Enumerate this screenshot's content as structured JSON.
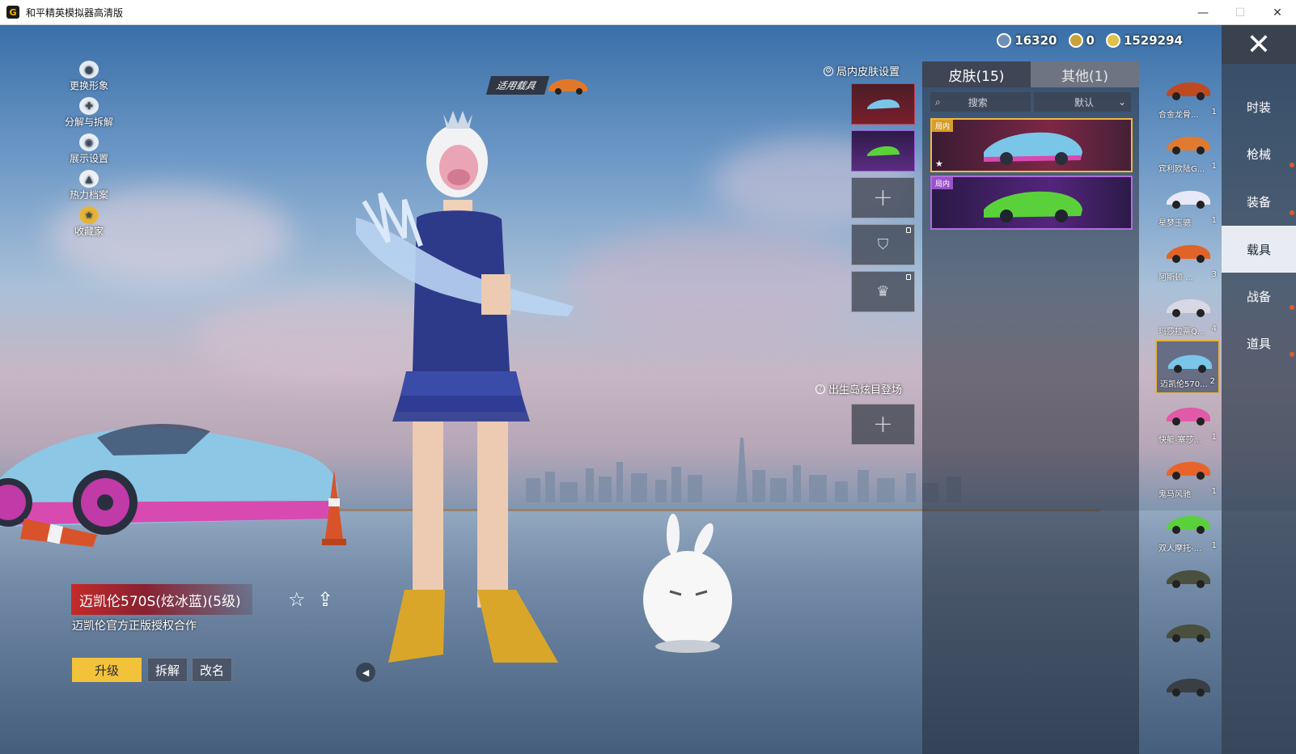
{
  "window": {
    "title": "和平精英模拟器高清版",
    "icon_letter": "G",
    "minimize": "—",
    "maximize": "☐",
    "close": "✕"
  },
  "currency": [
    {
      "name": "globe-coin",
      "value": "16320",
      "color": "#6f8fb8"
    },
    {
      "name": "token-coin",
      "value": "0",
      "color": "#caa23a"
    },
    {
      "name": "gold-coin",
      "value": "1529294",
      "color": "#e0c24a"
    }
  ],
  "side_menu": [
    {
      "label": "更换形象",
      "icon": "person-icon"
    },
    {
      "label": "分解与拆解",
      "icon": "puzzle-icon"
    },
    {
      "label": "展示设置",
      "icon": "eye-icon"
    },
    {
      "label": "热力档案",
      "icon": "flame-icon"
    },
    {
      "label": "收藏家",
      "icon": "badge-icon"
    }
  ],
  "vehicle_tag": {
    "label": "适用载具"
  },
  "in_match_skin": {
    "title": "局内皮肤设置"
  },
  "spawn_island": {
    "title": "出生岛炫目登场"
  },
  "panel": {
    "tabs": [
      {
        "label": "皮肤(15)",
        "active": true
      },
      {
        "label": "其他(1)",
        "active": false
      }
    ],
    "search_placeholder": "搜索",
    "sort_label": "默认",
    "cards": [
      {
        "badge": "局内",
        "color": "#7ac6e8",
        "selected": true
      },
      {
        "badge": "局内",
        "color": "#5ad13a",
        "selected": false
      }
    ]
  },
  "vehicles": [
    {
      "name": "合金龙骨...",
      "count": "1",
      "color": "#c04a20"
    },
    {
      "name": "宾利欧陆G...",
      "count": "1",
      "color": "#e07a30"
    },
    {
      "name": "星梦玉骢",
      "count": "1",
      "color": "#e8e8f8"
    },
    {
      "name": "阿斯顿 ...",
      "count": "3",
      "color": "#e0642a"
    },
    {
      "name": "玛莎拉蒂Q...",
      "count": "4",
      "color": "#d8d8e4"
    },
    {
      "name": "迈凯伦570...",
      "count": "2",
      "color": "#7ac6e8"
    },
    {
      "name": "快艇-塞莎...",
      "count": "1",
      "color": "#e05aa8"
    },
    {
      "name": "鬼马风驰",
      "count": "1",
      "color": "#e8642a"
    },
    {
      "name": "双人摩托-...",
      "count": "1",
      "color": "#5ad13a"
    },
    {
      "name": "",
      "count": "",
      "color": "#4a4f3e"
    },
    {
      "name": "",
      "count": "",
      "color": "#4a4f3e"
    },
    {
      "name": "",
      "count": "",
      "color": "#3a3f46"
    }
  ],
  "right_nav": [
    {
      "label": "时装",
      "active": false,
      "dot": false
    },
    {
      "label": "枪械",
      "active": false,
      "dot": true
    },
    {
      "label": "装备",
      "active": false,
      "dot": true
    },
    {
      "label": "载具",
      "active": true,
      "dot": false
    },
    {
      "label": "战备",
      "active": false,
      "dot": true
    },
    {
      "label": "道具",
      "active": false,
      "dot": true
    }
  ],
  "selected_vehicle": {
    "name": "迈凯伦570S(炫冰蓝)(5级)",
    "description": "迈凯伦官方正版授权合作"
  },
  "actions": {
    "upgrade": "升级",
    "dismantle": "拆解",
    "rename": "改名"
  }
}
